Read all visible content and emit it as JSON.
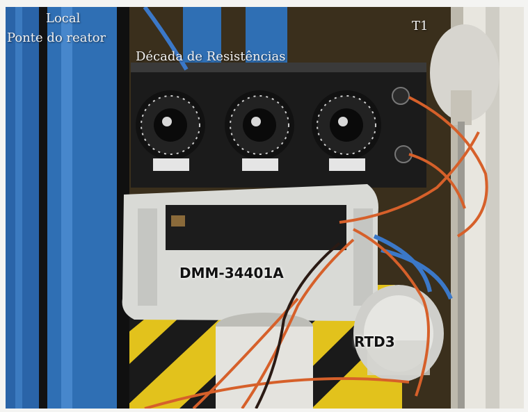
{
  "labels": {
    "local": "Local",
    "ponte": "Ponte do reator",
    "decada": "Década de Resistências",
    "t1": "T1",
    "dmm": "DMM-34401A",
    "rtd": "RTD3"
  },
  "colors": {
    "pipe_blue": "#2f6fb4",
    "panel_black": "#1b1b1b",
    "meter_body": "#d9dad6",
    "hazard_yellow": "#e2c21c",
    "wire_orange": "#d6602a",
    "wall_white": "#e8e6df"
  }
}
